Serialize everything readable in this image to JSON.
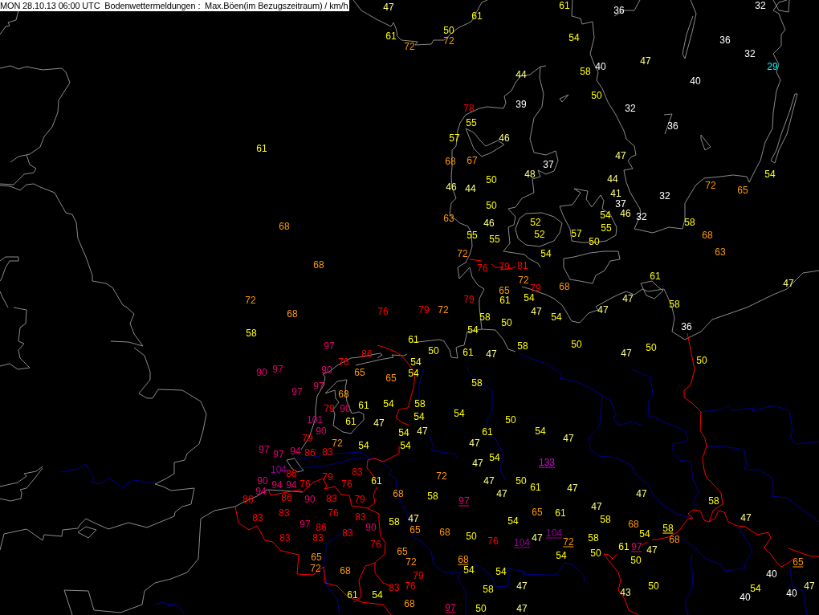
{
  "map": {
    "title": "MON 28.10.13 06:00 UTC  Bodenwettermeldungen :  Max.Böen(im Bezugszeitraum) / km/h",
    "stations": [
      {
        "value": "47",
        "color": "#ffff80",
        "underlined": false
      },
      {
        "value": "61",
        "color": "#ffff00",
        "underlined": false
      },
      {
        "value": "36",
        "color": "#ffffff",
        "underlined": false
      },
      {
        "value": "32",
        "color": "#ffffff",
        "underlined": false
      },
      {
        "value": "61",
        "color": "#ffff00",
        "underlined": false
      },
      {
        "value": "50",
        "color": "#ffff00",
        "underlined": false
      },
      {
        "value": "61",
        "color": "#ffff00",
        "underlined": false
      },
      {
        "value": "72",
        "color": "#ff9900",
        "underlined": false
      },
      {
        "value": "54",
        "color": "#ffff00",
        "underlined": false
      },
      {
        "value": "36",
        "color": "#ffffff",
        "underlined": false
      },
      {
        "value": "72",
        "color": "#ff9900",
        "underlined": false
      },
      {
        "value": "32",
        "color": "#ffffff",
        "underlined": false
      },
      {
        "value": "47",
        "color": "#ffff80",
        "underlined": false
      },
      {
        "value": "58",
        "color": "#ffff00",
        "underlined": false
      },
      {
        "value": "40",
        "color": "#ffffff",
        "underlined": false
      },
      {
        "value": "29",
        "color": "#00ffff",
        "underlined": false
      },
      {
        "value": "44",
        "color": "#ffff80",
        "underlined": false
      },
      {
        "value": "40",
        "color": "#ffffff",
        "underlined": false
      },
      {
        "value": "50",
        "color": "#ffff00",
        "underlined": false
      },
      {
        "value": "78",
        "color": "#ff0000",
        "underlined": false
      },
      {
        "value": "39",
        "color": "#ffffff",
        "underlined": false
      },
      {
        "value": "32",
        "color": "#ffffff",
        "underlined": false
      },
      {
        "value": "55",
        "color": "#ffff00",
        "underlined": false
      },
      {
        "value": "36",
        "color": "#ffffff",
        "underlined": false
      },
      {
        "value": "57",
        "color": "#ffff00",
        "underlined": false
      },
      {
        "value": "46",
        "color": "#ffff80",
        "underlined": false
      },
      {
        "value": "61",
        "color": "#ffff00",
        "underlined": false
      },
      {
        "value": "68",
        "color": "#ff9900",
        "underlined": false
      },
      {
        "value": "67",
        "color": "#ff9900",
        "underlined": false
      },
      {
        "value": "37",
        "color": "#ffffff",
        "underlined": false
      },
      {
        "value": "47",
        "color": "#ffff80",
        "underlined": false
      },
      {
        "value": "50",
        "color": "#ffff00",
        "underlined": false
      },
      {
        "value": "48",
        "color": "#ffff80",
        "underlined": false
      },
      {
        "value": "44",
        "color": "#ffff80",
        "underlined": false
      },
      {
        "value": "54",
        "color": "#ffff00",
        "underlined": false
      },
      {
        "value": "46",
        "color": "#ffff80",
        "underlined": false
      },
      {
        "value": "44",
        "color": "#ffff80",
        "underlined": false
      },
      {
        "value": "41",
        "color": "#ffff80",
        "underlined": false
      },
      {
        "value": "32",
        "color": "#ffffff",
        "underlined": false
      },
      {
        "value": "72",
        "color": "#ff9900",
        "underlined": false
      },
      {
        "value": "65",
        "color": "#ff9900",
        "underlined": false
      },
      {
        "value": "50",
        "color": "#ffff00",
        "underlined": false
      },
      {
        "value": "37",
        "color": "#ffffff",
        "underlined": false
      },
      {
        "value": "63",
        "color": "#ff9900",
        "underlined": false
      },
      {
        "value": "54",
        "color": "#ffff00",
        "underlined": false
      },
      {
        "value": "46",
        "color": "#ffff80",
        "underlined": false
      },
      {
        "value": "32",
        "color": "#ffffff",
        "underlined": false
      },
      {
        "value": "68",
        "color": "#ff9900",
        "underlined": false
      },
      {
        "value": "46",
        "color": "#ffff80",
        "underlined": false
      },
      {
        "value": "52",
        "color": "#ffff00",
        "underlined": false
      },
      {
        "value": "55",
        "color": "#ffff00",
        "underlined": false
      },
      {
        "value": "58",
        "color": "#ffff00",
        "underlined": false
      },
      {
        "value": "55",
        "color": "#ffff00",
        "underlined": false
      },
      {
        "value": "55",
        "color": "#ffff00",
        "underlined": false
      },
      {
        "value": "52",
        "color": "#ffff00",
        "underlined": false
      },
      {
        "value": "57",
        "color": "#ffff00",
        "underlined": false
      },
      {
        "value": "50",
        "color": "#ffff00",
        "underlined": false
      },
      {
        "value": "68",
        "color": "#ff9900",
        "underlined": false
      },
      {
        "value": "72",
        "color": "#ff9900",
        "underlined": false
      },
      {
        "value": "54",
        "color": "#ffff00",
        "underlined": false
      },
      {
        "value": "63",
        "color": "#ff9900",
        "underlined": false
      },
      {
        "value": "68",
        "color": "#ff9900",
        "underlined": false
      },
      {
        "value": "76",
        "color": "#ff0000",
        "underlined": false
      },
      {
        "value": "79",
        "color": "#ff0000",
        "underlined": false
      },
      {
        "value": "81",
        "color": "#ff0000",
        "underlined": false
      },
      {
        "value": "72",
        "color": "#ff9900",
        "underlined": false
      },
      {
        "value": "61",
        "color": "#ffff00",
        "underlined": false
      },
      {
        "value": "47",
        "color": "#ffff80",
        "underlined": false
      },
      {
        "value": "65",
        "color": "#ff9900",
        "underlined": false
      },
      {
        "value": "79",
        "color": "#ff0000",
        "underlined": false
      },
      {
        "value": "68",
        "color": "#ff9900",
        "underlined": false
      },
      {
        "value": "72",
        "color": "#ff9900",
        "underlined": false
      },
      {
        "value": "79",
        "color": "#ff0000",
        "underlined": false
      },
      {
        "value": "61",
        "color": "#ffff00",
        "underlined": false
      },
      {
        "value": "54",
        "color": "#ffff00",
        "underlined": false
      },
      {
        "value": "47",
        "color": "#ffff80",
        "underlined": false
      },
      {
        "value": "58",
        "color": "#ffff00",
        "underlined": false
      },
      {
        "value": "68",
        "color": "#ff9900",
        "underlined": false
      },
      {
        "value": "76",
        "color": "#ff0000",
        "underlined": false
      },
      {
        "value": "79",
        "color": "#ff0000",
        "underlined": false
      },
      {
        "value": "72",
        "color": "#ff9900",
        "underlined": false
      },
      {
        "value": "47",
        "color": "#ffff80",
        "underlined": false
      },
      {
        "value": "47",
        "color": "#ffff80",
        "underlined": false
      },
      {
        "value": "58",
        "color": "#ffff00",
        "underlined": false
      },
      {
        "value": "50",
        "color": "#ffff00",
        "underlined": false
      },
      {
        "value": "54",
        "color": "#ffff00",
        "underlined": false
      },
      {
        "value": "58",
        "color": "#ffff00",
        "underlined": false
      },
      {
        "value": "54",
        "color": "#ffff00",
        "underlined": false
      },
      {
        "value": "36",
        "color": "#ffffff",
        "underlined": false
      },
      {
        "value": "61",
        "color": "#ffff00",
        "underlined": false
      },
      {
        "value": "97",
        "color": "#e6006e",
        "underlined": false
      },
      {
        "value": "58",
        "color": "#ffff00",
        "underlined": false
      },
      {
        "value": "50",
        "color": "#ffff00",
        "underlined": false
      },
      {
        "value": "50",
        "color": "#ffff00",
        "underlined": false
      },
      {
        "value": "86",
        "color": "#ff0000",
        "underlined": false
      },
      {
        "value": "50",
        "color": "#ffff00",
        "underlined": false
      },
      {
        "value": "61",
        "color": "#ffff00",
        "underlined": false
      },
      {
        "value": "47",
        "color": "#ffff80",
        "underlined": false
      },
      {
        "value": "47",
        "color": "#ffff80",
        "underlined": false
      },
      {
        "value": "76",
        "color": "#ff0000",
        "underlined": false
      },
      {
        "value": "54",
        "color": "#ffff00",
        "underlined": false
      },
      {
        "value": "50",
        "color": "#ffff00",
        "underlined": false
      },
      {
        "value": "90",
        "color": "#e6006e",
        "underlined": false
      },
      {
        "value": "97",
        "color": "#e6006e",
        "underlined": false
      },
      {
        "value": "90",
        "color": "#e6006e",
        "underlined": false
      },
      {
        "value": "65",
        "color": "#ff9900",
        "underlined": false
      },
      {
        "value": "65",
        "color": "#ff9900",
        "underlined": false
      },
      {
        "value": "54",
        "color": "#ffff00",
        "underlined": false
      },
      {
        "value": "97",
        "color": "#e6006e",
        "underlined": false
      },
      {
        "value": "97",
        "color": "#e6006e",
        "underlined": false
      },
      {
        "value": "68",
        "color": "#ff9900",
        "underlined": false
      },
      {
        "value": "58",
        "color": "#ffff00",
        "underlined": false
      },
      {
        "value": "79",
        "color": "#ff0000",
        "underlined": false
      },
      {
        "value": "90",
        "color": "#e6006e",
        "underlined": false
      },
      {
        "value": "61",
        "color": "#ffff00",
        "underlined": false
      },
      {
        "value": "54",
        "color": "#ffff00",
        "underlined": false
      },
      {
        "value": "58",
        "color": "#ffff00",
        "underlined": false
      },
      {
        "value": "54",
        "color": "#ffff00",
        "underlined": false
      },
      {
        "value": "54",
        "color": "#ffff00",
        "underlined": false
      },
      {
        "value": "101",
        "color": "#cc0080",
        "underlined": false
      },
      {
        "value": "61",
        "color": "#ffff00",
        "underlined": false
      },
      {
        "value": "47",
        "color": "#ffff80",
        "underlined": false
      },
      {
        "value": "50",
        "color": "#ffff00",
        "underlined": false
      },
      {
        "value": "90",
        "color": "#e6006e",
        "underlined": false
      },
      {
        "value": "54",
        "color": "#ffff00",
        "underlined": false
      },
      {
        "value": "47",
        "color": "#ffff80",
        "underlined": false
      },
      {
        "value": "61",
        "color": "#ffff00",
        "underlined": false
      },
      {
        "value": "54",
        "color": "#ffff00",
        "underlined": false
      },
      {
        "value": "79",
        "color": "#ff0000",
        "underlined": false
      },
      {
        "value": "72",
        "color": "#ff9900",
        "underlined": false
      },
      {
        "value": "47",
        "color": "#ffff80",
        "underlined": false
      },
      {
        "value": "47",
        "color": "#ffff80",
        "underlined": false
      },
      {
        "value": "97",
        "color": "#e6006e",
        "underlined": false
      },
      {
        "value": "54",
        "color": "#ffff00",
        "underlined": false
      },
      {
        "value": "54",
        "color": "#ffff00",
        "underlined": false
      },
      {
        "value": "97",
        "color": "#e6006e",
        "underlined": false
      },
      {
        "value": "94",
        "color": "#e6006e",
        "underlined": false
      },
      {
        "value": "86",
        "color": "#ff0000",
        "underlined": false
      },
      {
        "value": "83",
        "color": "#ff0000",
        "underlined": false
      },
      {
        "value": "47",
        "color": "#ffff80",
        "underlined": false
      },
      {
        "value": "54",
        "color": "#ffff00",
        "underlined": false
      },
      {
        "value": "133",
        "color": "#dd00dd",
        "underlined": true
      },
      {
        "value": "104",
        "color": "#990099",
        "underlined": false
      },
      {
        "value": "86",
        "color": "#ff0000",
        "underlined": false
      },
      {
        "value": "83",
        "color": "#ff0000",
        "underlined": false
      },
      {
        "value": "90",
        "color": "#e6006e",
        "underlined": false
      },
      {
        "value": "79",
        "color": "#ff0000",
        "underlined": false
      },
      {
        "value": "61",
        "color": "#ffff00",
        "underlined": false
      },
      {
        "value": "72",
        "color": "#ff9900",
        "underlined": false
      },
      {
        "value": "94",
        "color": "#e6006e",
        "underlined": false
      },
      {
        "value": "94",
        "color": "#e6006e",
        "underlined": false
      },
      {
        "value": "76",
        "color": "#ff0000",
        "underlined": false
      },
      {
        "value": "76",
        "color": "#ff0000",
        "underlined": false
      },
      {
        "value": "47",
        "color": "#ffff80",
        "underlined": false
      },
      {
        "value": "50",
        "color": "#ffff00",
        "underlined": false
      },
      {
        "value": "94",
        "color": "#e6006e",
        "underlined": false
      },
      {
        "value": "68",
        "color": "#ff9900",
        "underlined": false
      },
      {
        "value": "58",
        "color": "#ffff00",
        "underlined": false
      },
      {
        "value": "47",
        "color": "#ffff80",
        "underlined": false
      },
      {
        "value": "61",
        "color": "#ffff00",
        "underlined": false
      },
      {
        "value": "47",
        "color": "#ffff80",
        "underlined": false
      },
      {
        "value": "47",
        "color": "#ffff80",
        "underlined": false
      },
      {
        "value": "86",
        "color": "#ff0000",
        "underlined": false
      },
      {
        "value": "86",
        "color": "#ff0000",
        "underlined": false
      },
      {
        "value": "90",
        "color": "#e6006e",
        "underlined": false
      },
      {
        "value": "83",
        "color": "#ff0000",
        "underlined": false
      },
      {
        "value": "79",
        "color": "#ff0000",
        "underlined": false
      },
      {
        "value": "97",
        "color": "#e6006e",
        "underlined": true
      },
      {
        "value": "47",
        "color": "#ffff80",
        "underlined": false
      },
      {
        "value": "58",
        "color": "#ffff00",
        "underlined": false
      },
      {
        "value": "83",
        "color": "#ff0000",
        "underlined": false
      },
      {
        "value": "83",
        "color": "#ff0000",
        "underlined": false
      },
      {
        "value": "76",
        "color": "#ff0000",
        "underlined": false
      },
      {
        "value": "83",
        "color": "#ff0000",
        "underlined": false
      },
      {
        "value": "65",
        "color": "#ff9900",
        "underlined": false
      },
      {
        "value": "61",
        "color": "#ffff00",
        "underlined": false
      },
      {
        "value": "58",
        "color": "#ffff00",
        "underlined": false
      },
      {
        "value": "47",
        "color": "#ffff80",
        "underlined": false
      },
      {
        "value": "54",
        "color": "#ffff00",
        "underlined": false
      },
      {
        "value": "58",
        "color": "#ffff00",
        "underlined": false
      },
      {
        "value": "47",
        "color": "#ffff80",
        "underlined": false
      },
      {
        "value": "97",
        "color": "#e6006e",
        "underlined": false
      },
      {
        "value": "86",
        "color": "#ff0000",
        "underlined": false
      },
      {
        "value": "90",
        "color": "#e6006e",
        "underlined": false
      },
      {
        "value": "68",
        "color": "#ff9900",
        "underlined": false
      },
      {
        "value": "83",
        "color": "#ff0000",
        "underlined": false
      },
      {
        "value": "65",
        "color": "#ff9900",
        "underlined": false
      },
      {
        "value": "68",
        "color": "#ff9900",
        "underlined": false
      },
      {
        "value": "104",
        "color": "#990099",
        "underlined": true
      },
      {
        "value": "54",
        "color": "#ffff00",
        "underlined": false
      },
      {
        "value": "58",
        "color": "#ffff00",
        "underlined": true
      },
      {
        "value": "83",
        "color": "#ff0000",
        "underlined": false
      },
      {
        "value": "83",
        "color": "#ff0000",
        "underlined": false
      },
      {
        "value": "50",
        "color": "#ffff00",
        "underlined": false
      },
      {
        "value": "76",
        "color": "#ff0000",
        "underlined": false
      },
      {
        "value": "47",
        "color": "#ffff80",
        "underlined": false
      },
      {
        "value": "58",
        "color": "#ffff00",
        "underlined": false
      },
      {
        "value": "76",
        "color": "#ff0000",
        "underlined": false
      },
      {
        "value": "104",
        "color": "#990099",
        "underlined": true
      },
      {
        "value": "72",
        "color": "#ff9900",
        "underlined": true
      },
      {
        "value": "61",
        "color": "#ffff00",
        "underlined": false
      },
      {
        "value": "97",
        "color": "#e6006e",
        "underlined": true
      },
      {
        "value": "68",
        "color": "#ff9900",
        "underlined": false
      },
      {
        "value": "65",
        "color": "#ff9900",
        "underlined": false
      },
      {
        "value": "50",
        "color": "#ffff00",
        "underlined": false
      },
      {
        "value": "47",
        "color": "#ffff80",
        "underlined": false
      },
      {
        "value": "65",
        "color": "#ff9900",
        "underlined": false
      },
      {
        "value": "72",
        "color": "#ff9900",
        "underlined": false
      },
      {
        "value": "68",
        "color": "#ff9900",
        "underlined": true
      },
      {
        "value": "54",
        "color": "#ffff00",
        "underlined": false
      },
      {
        "value": "50",
        "color": "#ffff00",
        "underlined": false
      },
      {
        "value": "65",
        "color": "#ff9900",
        "underlined": true
      },
      {
        "value": "72",
        "color": "#ff9900",
        "underlined": false
      },
      {
        "value": "68",
        "color": "#ff9900",
        "underlined": false
      },
      {
        "value": "79",
        "color": "#ff0000",
        "underlined": false
      },
      {
        "value": "54",
        "color": "#ffff00",
        "underlined": false
      },
      {
        "value": "54",
        "color": "#ffff00",
        "underlined": false
      },
      {
        "value": "40",
        "color": "#ffffff",
        "underlined": false
      },
      {
        "value": "83",
        "color": "#ff0000",
        "underlined": false
      },
      {
        "value": "76",
        "color": "#ff0000",
        "underlined": false
      },
      {
        "value": "58",
        "color": "#ffff00",
        "underlined": false
      },
      {
        "value": "47",
        "color": "#ffff80",
        "underlined": false
      },
      {
        "value": "50",
        "color": "#ffff00",
        "underlined": false
      },
      {
        "value": "54",
        "color": "#ffff00",
        "underlined": false
      },
      {
        "value": "47",
        "color": "#ffff80",
        "underlined": false
      },
      {
        "value": "61",
        "color": "#ffff00",
        "underlined": false
      },
      {
        "value": "54",
        "color": "#ffff00",
        "underlined": false
      },
      {
        "value": "43",
        "color": "#ffff80",
        "underlined": false
      },
      {
        "value": "40",
        "color": "#ffffff",
        "underlined": false
      },
      {
        "value": "40",
        "color": "#ffffff",
        "underlined": false
      },
      {
        "value": "68",
        "color": "#ff9900",
        "underlined": false
      },
      {
        "value": "97",
        "color": "#e6006e",
        "underlined": true
      },
      {
        "value": "50",
        "color": "#ffff00",
        "underlined": false
      },
      {
        "value": "47",
        "color": "#ffff80",
        "underlined": false
      }
    ]
  }
}
